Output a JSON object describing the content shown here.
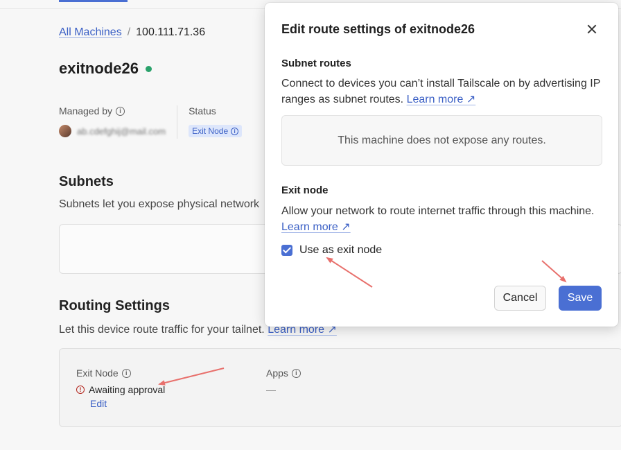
{
  "breadcrumb": {
    "parent": "All Machines",
    "separator": "/",
    "current": "100.111.71.36"
  },
  "machine": {
    "name": "exitnode26",
    "status_color": "#2aa26b"
  },
  "meta": {
    "managed_by_label": "Managed by",
    "status_label": "Status",
    "status_badge": "Exit Node"
  },
  "subnets": {
    "title": "Subnets",
    "description": "Subnets let you expose physical network"
  },
  "routing": {
    "title": "Routing Settings",
    "description": "Let this device route traffic for your tailnet.",
    "learn_more": "Learn more ↗",
    "exit_node_label": "Exit Node",
    "exit_node_status": "Awaiting approval",
    "edit_label": "Edit",
    "apps_label": "Apps",
    "apps_value": "—"
  },
  "dialog": {
    "title": "Edit route settings of exitnode26",
    "subnet_heading": "Subnet routes",
    "subnet_text": "Connect to devices you can’t install Tailscale on by advertising IP ranges as subnet routes.",
    "subnet_learn_more": "Learn more ↗",
    "no_routes": "This machine does not expose any routes.",
    "exit_heading": "Exit node",
    "exit_text": "Allow your network to route internet traffic through this machine.",
    "exit_learn_more": "Learn more ↗",
    "checkbox_label": "Use as exit node",
    "checkbox_checked": true,
    "cancel_label": "Cancel",
    "save_label": "Save"
  },
  "colors": {
    "accent": "#4a6fd3",
    "annotation_arrow": "#e8706c",
    "warning": "#b3261e"
  }
}
